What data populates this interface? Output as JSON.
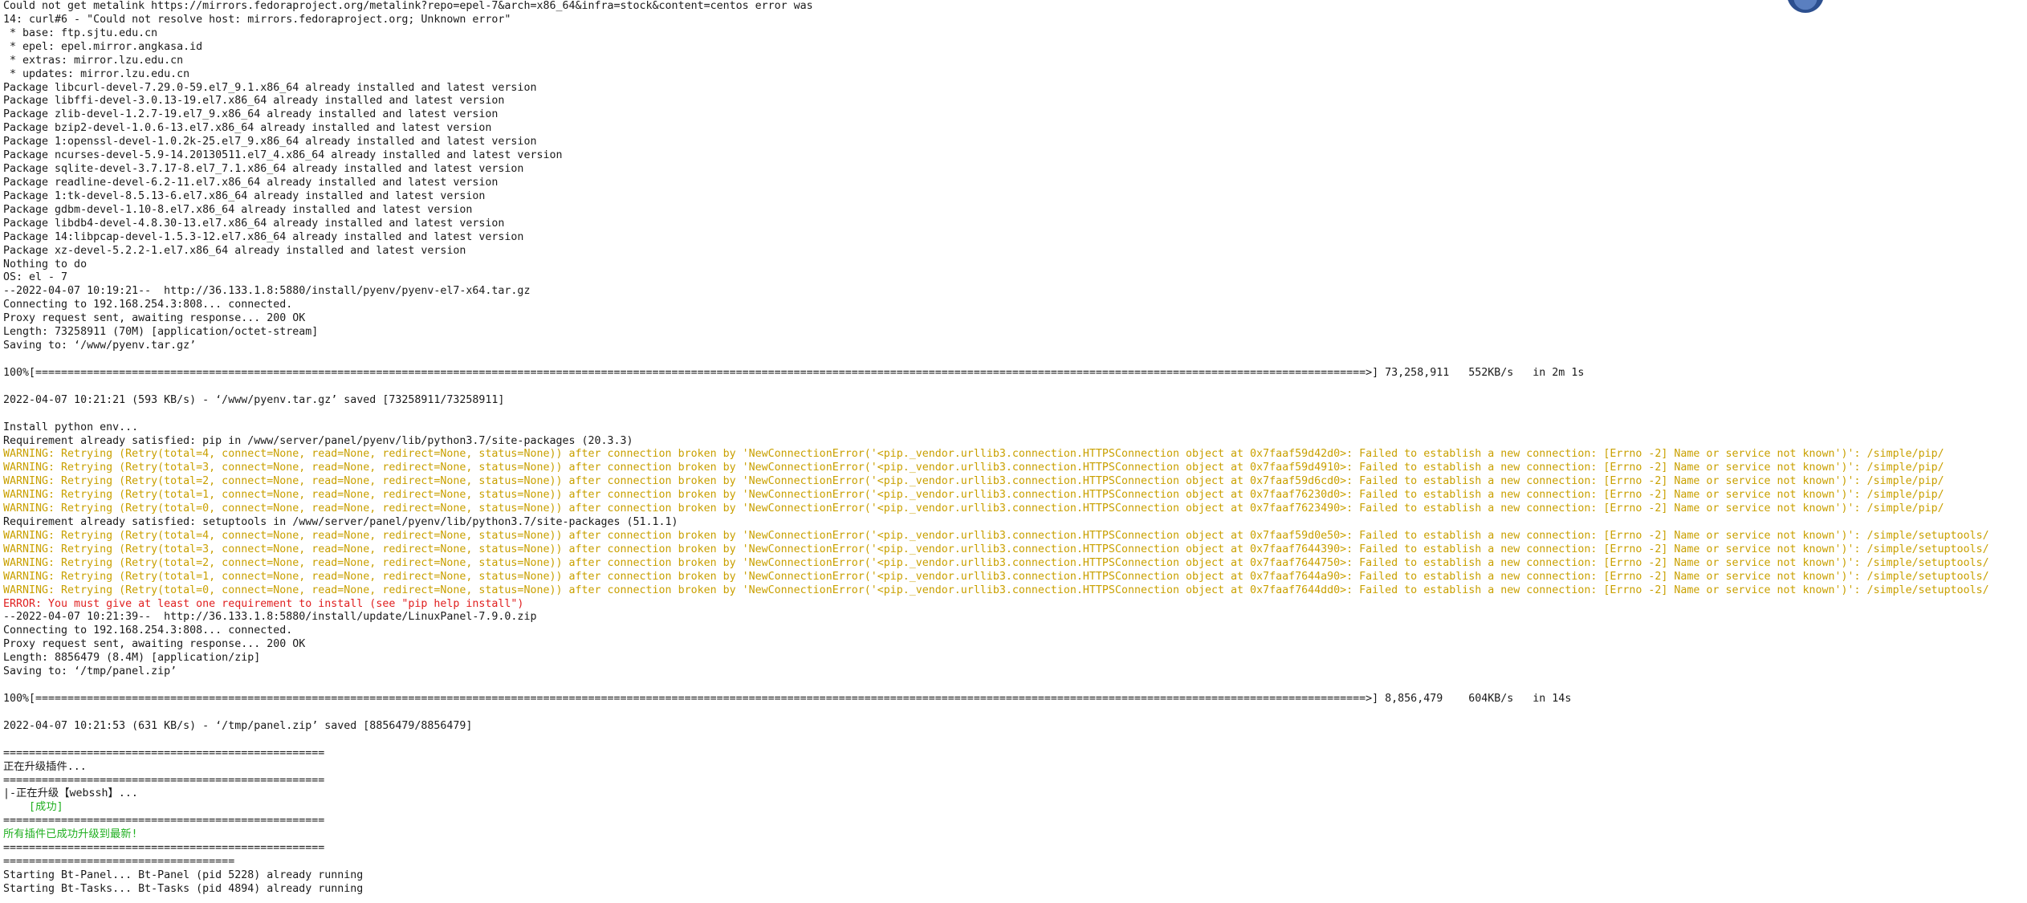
{
  "terminal": {
    "lines": [
      {
        "text": "Could not get metalink https://mirrors.fedoraproject.org/metalink?repo=epel-7&arch=x86_64&infra=stock&content=centos error was",
        "type": "normal"
      },
      {
        "text": "14: curl#6 - \"Could not resolve host: mirrors.fedoraproject.org; Unknown error\"",
        "type": "normal"
      },
      {
        "text": " * base: ftp.sjtu.edu.cn",
        "type": "normal"
      },
      {
        "text": " * epel: epel.mirror.angkasa.id",
        "type": "normal"
      },
      {
        "text": " * extras: mirror.lzu.edu.cn",
        "type": "normal"
      },
      {
        "text": " * updates: mirror.lzu.edu.cn",
        "type": "normal"
      },
      {
        "text": "Package libcurl-devel-7.29.0-59.el7_9.1.x86_64 already installed and latest version",
        "type": "normal"
      },
      {
        "text": "Package libffi-devel-3.0.13-19.el7.x86_64 already installed and latest version",
        "type": "normal"
      },
      {
        "text": "Package zlib-devel-1.2.7-19.el7_9.x86_64 already installed and latest version",
        "type": "normal"
      },
      {
        "text": "Package bzip2-devel-1.0.6-13.el7.x86_64 already installed and latest version",
        "type": "normal"
      },
      {
        "text": "Package 1:openssl-devel-1.0.2k-25.el7_9.x86_64 already installed and latest version",
        "type": "normal"
      },
      {
        "text": "Package ncurses-devel-5.9-14.20130511.el7_4.x86_64 already installed and latest version",
        "type": "normal"
      },
      {
        "text": "Package sqlite-devel-3.7.17-8.el7_7.1.x86_64 already installed and latest version",
        "type": "normal"
      },
      {
        "text": "Package readline-devel-6.2-11.el7.x86_64 already installed and latest version",
        "type": "normal"
      },
      {
        "text": "Package 1:tk-devel-8.5.13-6.el7.x86_64 already installed and latest version",
        "type": "normal"
      },
      {
        "text": "Package gdbm-devel-1.10-8.el7.x86_64 already installed and latest version",
        "type": "normal"
      },
      {
        "text": "Package libdb4-devel-4.8.30-13.el7.x86_64 already installed and latest version",
        "type": "normal"
      },
      {
        "text": "Package 14:libpcap-devel-1.5.3-12.el7.x86_64 already installed and latest version",
        "type": "normal"
      },
      {
        "text": "Package xz-devel-5.2.2-1.el7.x86_64 already installed and latest version",
        "type": "normal"
      },
      {
        "text": "Nothing to do",
        "type": "normal"
      },
      {
        "text": "OS: el - 7",
        "type": "normal"
      },
      {
        "text": "--2022-04-07 10:19:21--  http://36.133.1.8:5880/install/pyenv/pyenv-el7-x64.tar.gz",
        "type": "normal"
      },
      {
        "text": "Connecting to 192.168.254.3:808... connected.",
        "type": "normal"
      },
      {
        "text": "Proxy request sent, awaiting response... 200 OK",
        "type": "normal"
      },
      {
        "text": "Length: 73258911 (70M) [application/octet-stream]",
        "type": "normal"
      },
      {
        "text": "Saving to: ‘/www/pyenv.tar.gz’",
        "type": "normal"
      },
      {
        "text": "",
        "type": "normal"
      },
      {
        "text": "100%[===============================================================================================================================================================================================================>] 73,258,911   552KB/s   in 2m 1s",
        "type": "progress"
      },
      {
        "text": "",
        "type": "normal"
      },
      {
        "text": "2022-04-07 10:21:21 (593 KB/s) - ‘/www/pyenv.tar.gz’ saved [73258911/73258911]",
        "type": "normal"
      },
      {
        "text": "",
        "type": "normal"
      },
      {
        "text": "Install python env...",
        "type": "normal"
      },
      {
        "text": "Requirement already satisfied: pip in /www/server/panel/pyenv/lib/python3.7/site-packages (20.3.3)",
        "type": "normal"
      },
      {
        "text": "WARNING: Retrying (Retry(total=4, connect=None, read=None, redirect=None, status=None)) after connection broken by 'NewConnectionError('<pip._vendor.urllib3.connection.HTTPSConnection object at 0x7faaf59d42d0>: Failed to establish a new connection: [Errno -2] Name or service not known')': /simple/pip/",
        "type": "warn"
      },
      {
        "text": "WARNING: Retrying (Retry(total=3, connect=None, read=None, redirect=None, status=None)) after connection broken by 'NewConnectionError('<pip._vendor.urllib3.connection.HTTPSConnection object at 0x7faaf59d4910>: Failed to establish a new connection: [Errno -2] Name or service not known')': /simple/pip/",
        "type": "warn"
      },
      {
        "text": "WARNING: Retrying (Retry(total=2, connect=None, read=None, redirect=None, status=None)) after connection broken by 'NewConnectionError('<pip._vendor.urllib3.connection.HTTPSConnection object at 0x7faaf59d6cd0>: Failed to establish a new connection: [Errno -2] Name or service not known')': /simple/pip/",
        "type": "warn"
      },
      {
        "text": "WARNING: Retrying (Retry(total=1, connect=None, read=None, redirect=None, status=None)) after connection broken by 'NewConnectionError('<pip._vendor.urllib3.connection.HTTPSConnection object at 0x7faaf76230d0>: Failed to establish a new connection: [Errno -2] Name or service not known')': /simple/pip/",
        "type": "warn"
      },
      {
        "text": "WARNING: Retrying (Retry(total=0, connect=None, read=None, redirect=None, status=None)) after connection broken by 'NewConnectionError('<pip._vendor.urllib3.connection.HTTPSConnection object at 0x7faaf7623490>: Failed to establish a new connection: [Errno -2] Name or service not known')': /simple/pip/",
        "type": "warn"
      },
      {
        "text": "Requirement already satisfied: setuptools in /www/server/panel/pyenv/lib/python3.7/site-packages (51.1.1)",
        "type": "normal"
      },
      {
        "text": "WARNING: Retrying (Retry(total=4, connect=None, read=None, redirect=None, status=None)) after connection broken by 'NewConnectionError('<pip._vendor.urllib3.connection.HTTPSConnection object at 0x7faaf59d0e50>: Failed to establish a new connection: [Errno -2] Name or service not known')': /simple/setuptools/",
        "type": "warn"
      },
      {
        "text": "WARNING: Retrying (Retry(total=3, connect=None, read=None, redirect=None, status=None)) after connection broken by 'NewConnectionError('<pip._vendor.urllib3.connection.HTTPSConnection object at 0x7faaf7644390>: Failed to establish a new connection: [Errno -2] Name or service not known')': /simple/setuptools/",
        "type": "warn"
      },
      {
        "text": "WARNING: Retrying (Retry(total=2, connect=None, read=None, redirect=None, status=None)) after connection broken by 'NewConnectionError('<pip._vendor.urllib3.connection.HTTPSConnection object at 0x7faaf7644750>: Failed to establish a new connection: [Errno -2] Name or service not known')': /simple/setuptools/",
        "type": "warn"
      },
      {
        "text": "WARNING: Retrying (Retry(total=1, connect=None, read=None, redirect=None, status=None)) after connection broken by 'NewConnectionError('<pip._vendor.urllib3.connection.HTTPSConnection object at 0x7faaf7644a90>: Failed to establish a new connection: [Errno -2] Name or service not known')': /simple/setuptools/",
        "type": "warn"
      },
      {
        "text": "WARNING: Retrying (Retry(total=0, connect=None, read=None, redirect=None, status=None)) after connection broken by 'NewConnectionError('<pip._vendor.urllib3.connection.HTTPSConnection object at 0x7faaf7644dd0>: Failed to establish a new connection: [Errno -2] Name or service not known')': /simple/setuptools/",
        "type": "warn"
      },
      {
        "text": "ERROR: You must give at least one requirement to install (see \"pip help install\")",
        "type": "err"
      },
      {
        "text": "--2022-04-07 10:21:39--  http://36.133.1.8:5880/install/update/LinuxPanel-7.9.0.zip",
        "type": "normal"
      },
      {
        "text": "Connecting to 192.168.254.3:808... connected.",
        "type": "normal"
      },
      {
        "text": "Proxy request sent, awaiting response... 200 OK",
        "type": "normal"
      },
      {
        "text": "Length: 8856479 (8.4M) [application/zip]",
        "type": "normal"
      },
      {
        "text": "Saving to: ‘/tmp/panel.zip’",
        "type": "normal"
      },
      {
        "text": "",
        "type": "normal"
      },
      {
        "text": "100%[===============================================================================================================================================================================================================>] 8,856,479    604KB/s   in 14s",
        "type": "progress"
      },
      {
        "text": "",
        "type": "normal"
      },
      {
        "text": "2022-04-07 10:21:53 (631 KB/s) - ‘/tmp/panel.zip’ saved [8856479/8856479]",
        "type": "normal"
      },
      {
        "text": "",
        "type": "normal"
      },
      {
        "text": "==================================================",
        "type": "normal"
      },
      {
        "text": "正在升级插件...",
        "type": "normal"
      },
      {
        "text": "==================================================",
        "type": "normal"
      },
      {
        "text": "|-正在升级【webssh】...",
        "type": "normal"
      },
      {
        "text": "    [成功]",
        "type": "ok"
      },
      {
        "text": "==================================================",
        "type": "normal"
      },
      {
        "text": "所有插件已成功升级到最新!",
        "type": "ok"
      },
      {
        "text": "==================================================",
        "type": "normal"
      },
      {
        "text": "====================================",
        "type": "normal"
      },
      {
        "text": "Starting Bt-Panel... Bt-Panel (pid 5228) already running",
        "type": "normal"
      },
      {
        "text": "Starting Bt-Tasks... Bt-Tasks (pid 4894) already running",
        "type": "normal"
      }
    ]
  },
  "colors": {
    "background": "#ffffff",
    "text": "#1a1a1a",
    "warning": "#c9a000",
    "error": "#e02020",
    "success": "#22b022"
  }
}
